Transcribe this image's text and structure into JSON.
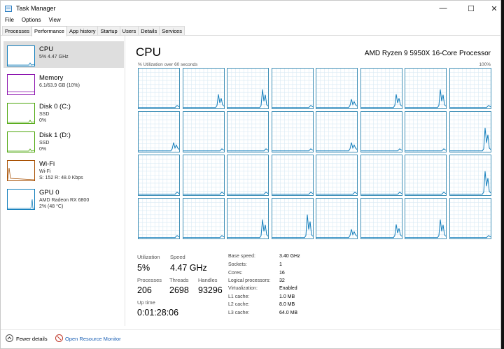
{
  "window": {
    "title": "Task Manager",
    "minimize": "—",
    "maximize": "☐",
    "close": "✕"
  },
  "menu": [
    "File",
    "Options",
    "View"
  ],
  "tabs": [
    "Processes",
    "Performance",
    "App history",
    "Startup",
    "Users",
    "Details",
    "Services"
  ],
  "active_tab": "Performance",
  "sidebar": [
    {
      "title": "CPU",
      "sub1": "5% 4.47 GHz",
      "sub2": "",
      "color": "#117dbb"
    },
    {
      "title": "Memory",
      "sub1": "6.1/63.9 GB (10%)",
      "sub2": "",
      "color": "#8b12ae"
    },
    {
      "title": "Disk 0 (C:)",
      "sub1": "SSD",
      "sub2": "0%",
      "color": "#4da60c"
    },
    {
      "title": "Disk 1 (D:)",
      "sub1": "SSD",
      "sub2": "0%",
      "color": "#4da60c"
    },
    {
      "title": "Wi-Fi",
      "sub1": "Wi-Fi",
      "sub2": "S: 152 R: 48.0 Kbps",
      "color": "#a74f01"
    },
    {
      "title": "GPU 0",
      "sub1": "AMD Radeon RX 6800",
      "sub2": "2% (48 °C)",
      "color": "#117dbb"
    }
  ],
  "main": {
    "title": "CPU",
    "processor": "AMD Ryzen 9 5950X 16-Core Processor",
    "util_caption": "% Utilization over 60 seconds",
    "max_pct": "100%",
    "graph_color": "#117dbb",
    "grid_color": "#d9eaf4"
  },
  "stats": {
    "utilization_label": "Utilization",
    "utilization": "5%",
    "speed_label": "Speed",
    "speed": "4.47 GHz",
    "processes_label": "Processes",
    "processes": "206",
    "threads_label": "Threads",
    "threads": "2698",
    "handles_label": "Handles",
    "handles": "93296",
    "uptime_label": "Up time",
    "uptime": "0:01:28:06"
  },
  "specs": [
    {
      "label": "Base speed:",
      "value": "3.40 GHz"
    },
    {
      "label": "Sockets:",
      "value": "1"
    },
    {
      "label": "Cores:",
      "value": "16"
    },
    {
      "label": "Logical processors:",
      "value": "32"
    },
    {
      "label": "Virtualization:",
      "value": "Enabled"
    },
    {
      "label": "L1 cache:",
      "value": "1.0 MB"
    },
    {
      "label": "L2 cache:",
      "value": "8.0 MB"
    },
    {
      "label": "L3 cache:",
      "value": "64.0 MB"
    }
  ],
  "footer": {
    "fewer_details": "Fewer details",
    "open_monitor": "Open Resource Monitor"
  }
}
